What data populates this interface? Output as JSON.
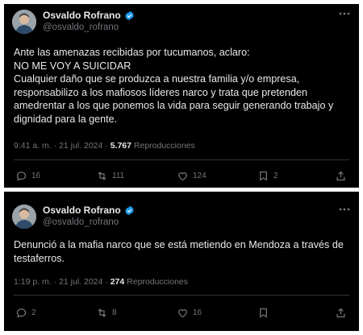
{
  "posts": [
    {
      "author": {
        "name": "Osvaldo Rofrano",
        "handle": "@osvaldo_rofrano"
      },
      "text_lines": [
        "Ante las amenazas recibidas por tucumanos, aclaro:",
        "NO ME VOY A SUICIDAR",
        "Cualquier daño que se produzca a nuestra familia y/o empresa,",
        "responsabilizo a los mafiosos líderes narco y trata que pretenden",
        "amedrentar a los que ponemos la vida para seguir generando trabajo y",
        "dignidad para la gente."
      ],
      "time": "9:41 a. m.",
      "date": "21 jul. 2024",
      "views": "5.767",
      "views_label": "Reproducciones",
      "replies": "16",
      "reposts": "111",
      "likes": "124",
      "bookmarks": "2"
    },
    {
      "author": {
        "name": "Osvaldo Rofrano",
        "handle": "@osvaldo_rofrano"
      },
      "text_lines": [
        "Denunció a la mafia narco que se está metiendo en Mendoza a través de",
        "testaferros."
      ],
      "time": "1:19 p. m.",
      "date": "21 jul. 2024",
      "views": "274",
      "views_label": "Reproducciones",
      "replies": "2",
      "reposts": "8",
      "likes": "16",
      "bookmarks": ""
    }
  ],
  "separator": "·",
  "colors": {
    "background": "#000000",
    "text": "#e7e9ea",
    "secondary": "#71767b",
    "verified": "#1d9bf0",
    "divider": "#2f3336"
  },
  "icons": [
    "verified-badge-icon",
    "more-options-icon",
    "reply-icon",
    "repost-icon",
    "like-icon",
    "bookmark-icon",
    "share-icon"
  ]
}
